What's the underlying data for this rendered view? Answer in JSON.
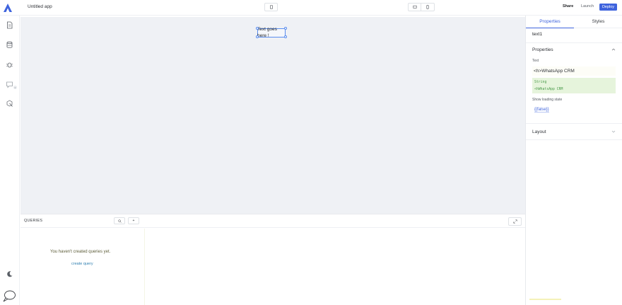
{
  "header": {
    "app_title": "Untitled app",
    "share_label": "Share",
    "launch_label": "Launch",
    "deploy_label": "Deploy"
  },
  "canvas": {
    "widget_text": "Text goes here !"
  },
  "queries": {
    "title": "QUERIES",
    "search_icon": "search-icon",
    "add_label": "+",
    "empty_message": "You haven't created queries yet.",
    "create_link": "create query"
  },
  "inspector": {
    "tabs": [
      "Properties",
      "Styles"
    ],
    "component_name": "text1",
    "properties_section": "Properties",
    "text_label": "Text",
    "text_value": "<h>WhatsApp CRM",
    "preview_type": "String",
    "preview_value": "<hWhatsApp CRM",
    "loading_label": "Show loading state",
    "loading_value": "{{false}}",
    "layout_section": "Layout"
  },
  "colors": {
    "accent": "#3e63dd",
    "canvas_bg": "#eff1f5",
    "preview_bg": "#e6f4dc"
  }
}
